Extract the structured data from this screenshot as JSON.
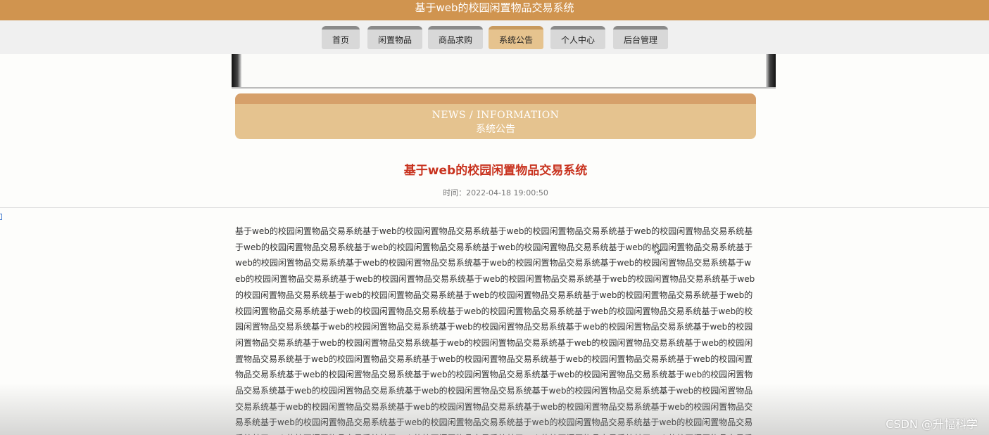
{
  "app": {
    "title": "基于web的校园闲置物品交易系统"
  },
  "nav": {
    "items": [
      {
        "label": "首页",
        "active": false
      },
      {
        "label": "闲置物品",
        "active": false
      },
      {
        "label": "商品求购",
        "active": false
      },
      {
        "label": "系统公告",
        "active": true
      },
      {
        "label": "个人中心",
        "active": false
      },
      {
        "label": "后台管理",
        "active": false
      }
    ]
  },
  "section": {
    "heading_en": "NEWS / INFORMATION",
    "heading_cn": "系统公告"
  },
  "article": {
    "title": "基于web的校园闲置物品交易系统",
    "time": "时间：2022-04-18 19:00:50",
    "body": "基于web的校园闲置物品交易系统基于web的校园闲置物品交易系统基于web的校园闲置物品交易系统基于web的校园闲置物品交易系统基于web的校园闲置物品交易系统基于web的校园闲置物品交易系统基于web的校园闲置物品交易系统基于web的校园闲置物品交易系统基于web的校园闲置物品交易系统基于web的校园闲置物品交易系统基于web的校园闲置物品交易系统基于web的校园闲置物品交易系统基于web的校园闲置物品交易系统基于web的校园闲置物品交易系统基于web的校园闲置物品交易系统基于web的校园闲置物品交易系统基于web的校园闲置物品交易系统基于web的校园闲置物品交易系统基于web的校园闲置物品交易系统基于web的校园闲置物品交易系统基于web的校园闲置物品交易系统基于web的校园闲置物品交易系统基于web的校园闲置物品交易系统基于web的校园闲置物品交易系统基于web的校园闲置物品交易系统基于web的校园闲置物品交易系统基于web的校园闲置物品交易系统基于web的校园闲置物品交易系统基于web的校园闲置物品交易系统基于web的校园闲置物品交易系统基于web的校园闲置物品交易系统基于web的校园闲置物品交易系统基于web的校园闲置物品交易系统基于web的校园闲置物品交易系统基于web的校园闲置物品交易系统基于web的校园闲置物品交易系统基于web的校园闲置物品交易系统基于web的校园闲置物品交易系统基于web的校园闲置物品交易系统基于web的校园闲置物品交易系统基于web的校园闲置物品交易系统基于web的校园闲置物品交易系统基于web的校园闲置物品交易系统基于web的校园闲置物品交易系统基于web的校园闲置物品交易系统基于web的校园闲置物品交易系统基于web的校园闲置物品交易系统基于web的校园闲置物品交易系统基于web的校园闲置物品交易系统基于web的校园闲置物品交易系统基于web的校园闲置物品交易系统基于web的校园闲置物品交易系统基于web的校园闲置物品交易系统基于web的校园闲置物品交易系统基于web的校园闲置物品交易系统基于web的校园闲置物品交易系统基于web的校园闲置物品交易系统基于web的校园闲置物品交易系统基于web的校园闲置物品交易系统基于web的校园闲置物品交易系统基于web的校园闲置物品交易系统基于web的校园闲置物品交易系统基于web的校园闲置物品交易系统基于web的校园闲置物品交易系统基于web的校园闲置物品交易系统基于web的校园闲置物品交易系统基于web的校园闲置物品交易系统基于web的校园闲置物品交易系统基于web的校园闲置物品交易系统基于web的校园闲置物品交易系统基于web的校园闲置物品交易系统基于web的校园闲置物品交易系统基于web的校园闲置物品交易系统基于web的校园闲置物品交易系统基于web的校园闲置物品交易系统基于web的校园闲置物品交易系统基于web的校园闲置物品交易系统"
  },
  "watermark": {
    "text": "CSDN @升幅科学"
  },
  "colors": {
    "header_bg": "#d0944f",
    "nav_bg": "#f0f0f0",
    "nav_tab": "#d8d8d8",
    "nav_tab_active": "#e6c38e",
    "section_head": "#e5c38f",
    "title_red": "#c8321e"
  },
  "icons": {
    "cursor": "mouse-pointer-icon"
  }
}
